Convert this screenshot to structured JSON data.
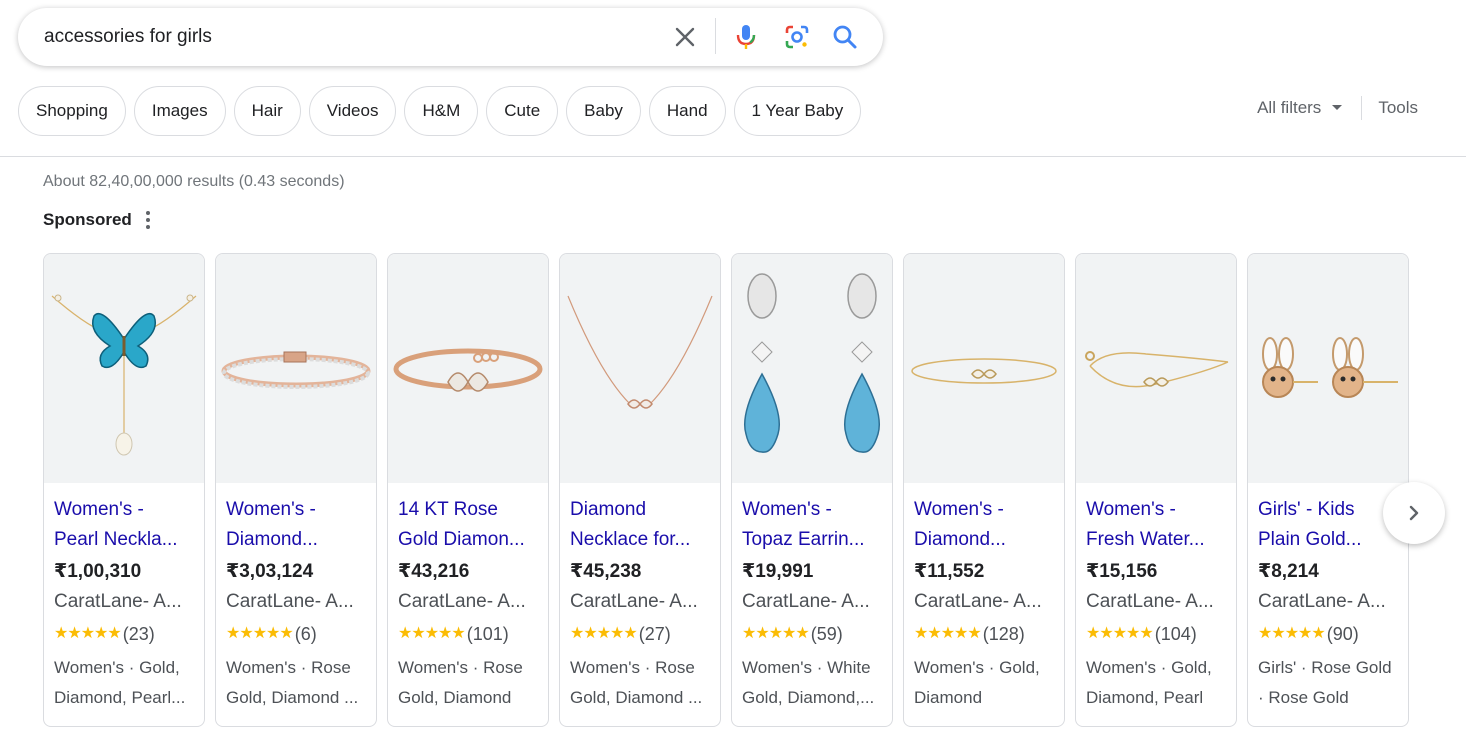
{
  "search": {
    "query": "accessories for girls",
    "icons": [
      "clear-icon",
      "microphone-icon",
      "lens-icon",
      "search-icon"
    ]
  },
  "chips": [
    "Shopping",
    "Images",
    "Hair",
    "Videos",
    "H&M",
    "Cute",
    "Baby",
    "Hand",
    "1 Year Baby"
  ],
  "filters": {
    "all_filters": "All filters",
    "tools": "Tools"
  },
  "stats": "About 82,40,00,000 results (0.43 seconds)",
  "sponsored_label": "Sponsored",
  "colors": {
    "link": "#1a0dab",
    "star": "#fbbc04",
    "chip_border": "#dadce0"
  },
  "products": [
    {
      "title_l1": "Women's -",
      "title_l2": "Pearl Neckla...",
      "price": "₹1,00,310",
      "seller": "CaratLane- A...",
      "stars": "★★★★★",
      "reviews": "(23)",
      "desc_l1": "Women's · Gold,",
      "desc_l2": "Diamond, Pearl...",
      "image": "butterfly-necklace"
    },
    {
      "title_l1": "Women's -",
      "title_l2": "Diamond...",
      "price": "₹3,03,124",
      "seller": "CaratLane- A...",
      "stars": "★★★★★",
      "reviews": "(6)",
      "desc_l1": "Women's · Rose",
      "desc_l2": "Gold, Diamond ...",
      "image": "tennis-bracelet"
    },
    {
      "title_l1": "14 KT Rose",
      "title_l2": "Gold Diamon...",
      "price": "₹43,216",
      "seller": "CaratLane- A...",
      "stars": "★★★★★",
      "reviews": "(101)",
      "desc_l1": "Women's · Rose",
      "desc_l2": "Gold, Diamond",
      "image": "infinity-bangle"
    },
    {
      "title_l1": "Diamond",
      "title_l2": "Necklace for...",
      "price": "₹45,238",
      "seller": "CaratLane- A...",
      "stars": "★★★★★",
      "reviews": "(27)",
      "desc_l1": "Women's · Rose",
      "desc_l2": "Gold, Diamond ...",
      "image": "infinity-necklace"
    },
    {
      "title_l1": "Women's -",
      "title_l2": "Topaz Earrin...",
      "price": "₹19,991",
      "seller": "CaratLane- A...",
      "stars": "★★★★★",
      "reviews": "(59)",
      "desc_l1": "Women's · White",
      "desc_l2": "Gold, Diamond,...",
      "image": "topaz-earrings"
    },
    {
      "title_l1": "Women's -",
      "title_l2": "Diamond...",
      "price": "₹11,552",
      "seller": "CaratLane- A...",
      "stars": "★★★★★",
      "reviews": "(128)",
      "desc_l1": "Women's · Gold,",
      "desc_l2": "Diamond",
      "image": "infinity-bracelet"
    },
    {
      "title_l1": "Women's -",
      "title_l2": "Fresh Water...",
      "price": "₹15,156",
      "seller": "CaratLane- A...",
      "stars": "★★★★★",
      "reviews": "(104)",
      "desc_l1": "Women's · Gold,",
      "desc_l2": "Diamond, Pearl",
      "image": "chain-bracelet"
    },
    {
      "title_l1": "Girls' - Kids",
      "title_l2": "Plain Gold...",
      "price": "₹8,214",
      "seller": "CaratLane- A...",
      "stars": "★★★★★",
      "reviews": "(90)",
      "desc_l1": "Girls' · Rose Gold",
      "desc_l2": "· Rose Gold",
      "image": "bunny-earrings"
    }
  ]
}
